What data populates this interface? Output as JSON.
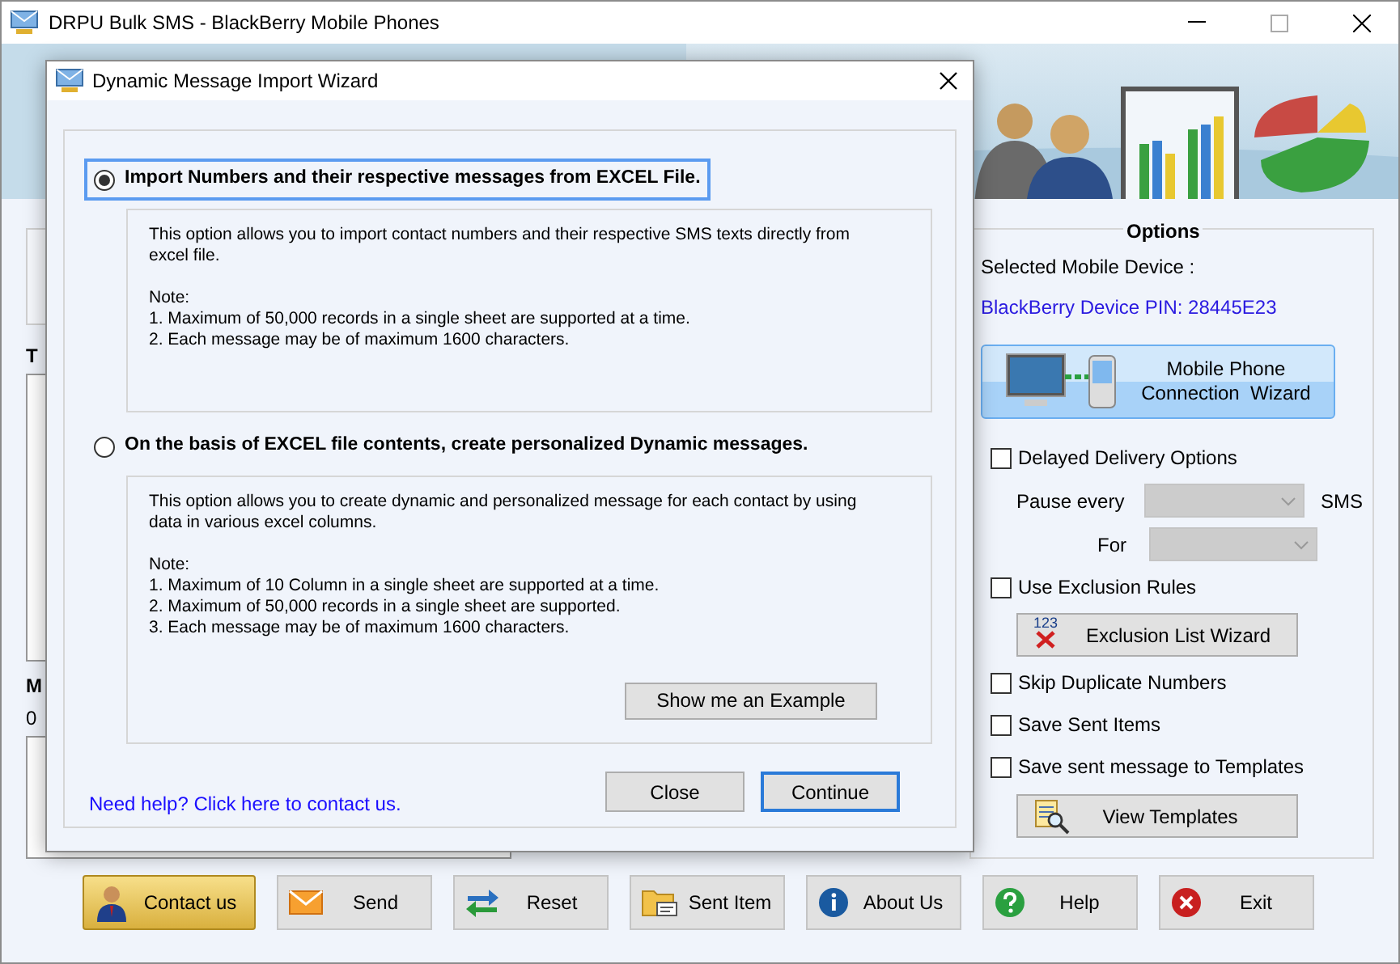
{
  "window": {
    "title": "DRPU Bulk SMS - BlackBerry Mobile Phones"
  },
  "main_panel": {
    "to_label": "T",
    "message_label": "M",
    "count": "0"
  },
  "dialog": {
    "title": "Dynamic Message Import Wizard",
    "options": [
      {
        "label": "Import Numbers and their respective messages from EXCEL File.",
        "selected": true,
        "description": "This option allows you to import contact numbers and their respective SMS texts directly from excel file.",
        "note_title": "Note:",
        "notes": [
          "1. Maximum of 50,000 records in a single sheet are supported at a time.",
          "2. Each message may be of maximum 1600 characters."
        ]
      },
      {
        "label": "On the basis of EXCEL file contents, create personalized Dynamic messages.",
        "selected": false,
        "description": "This option allows you to create dynamic and personalized message for each contact by using data in various excel columns.",
        "note_title": "Note:",
        "notes": [
          "1. Maximum of 10 Column in a single sheet are supported at a time.",
          "2. Maximum of 50,000 records in a single sheet are supported.",
          "3. Each message may be of maximum 1600 characters."
        ],
        "example_button": "Show me an Example"
      }
    ],
    "help_link": "Need help? Click here to contact us.",
    "buttons": [
      {
        "label": "Close",
        "focused": false
      },
      {
        "label": "Continue",
        "focused": true
      }
    ]
  },
  "options": {
    "title": "Options",
    "device_label": "Selected Mobile Device :",
    "device_value": "BlackBerry Device PIN: 28445E23",
    "connection_button": [
      "Mobile Phone",
      "Connection  Wizard"
    ],
    "items": [
      {
        "kind": "checkbox",
        "label": "Delayed Delivery Options",
        "checked": false
      },
      {
        "kind": "pause",
        "label": "Pause every",
        "unit": "SMS"
      },
      {
        "kind": "for",
        "label": "For"
      },
      {
        "kind": "checkbox",
        "label": "Use Exclusion Rules",
        "checked": false
      },
      {
        "kind": "exclusion_button",
        "label": "Exclusion List Wizard",
        "badge": "123"
      },
      {
        "kind": "checkbox",
        "label": "Skip Duplicate Numbers",
        "checked": false
      },
      {
        "kind": "checkbox",
        "label": "Save Sent Items",
        "checked": false
      },
      {
        "kind": "checkbox",
        "label": "Save sent message to Templates",
        "checked": false
      },
      {
        "kind": "templates_button",
        "label": "View Templates"
      }
    ]
  },
  "toolbar": [
    {
      "kind": "contact",
      "label": "Contact us"
    },
    {
      "kind": "send",
      "label": "Send"
    },
    {
      "kind": "reset",
      "label": "Reset"
    },
    {
      "kind": "sent",
      "label": "Sent Item"
    },
    {
      "kind": "about",
      "label": "About Us"
    },
    {
      "kind": "help",
      "label": "Help"
    },
    {
      "kind": "exit",
      "label": "Exit"
    }
  ]
}
